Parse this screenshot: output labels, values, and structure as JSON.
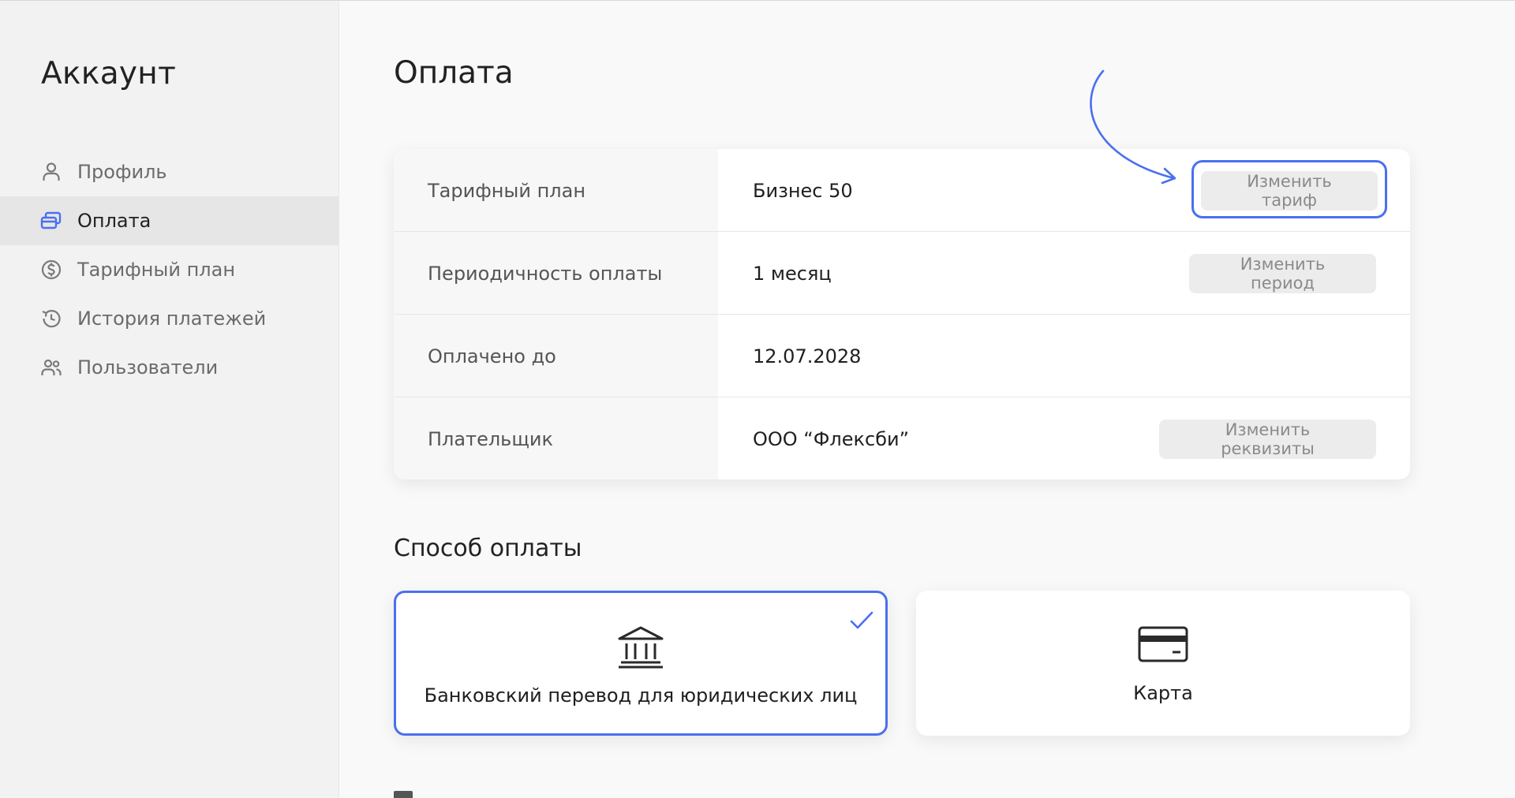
{
  "sidebar": {
    "title": "Аккаунт",
    "items": [
      {
        "label": "Профиль",
        "icon": "user-icon"
      },
      {
        "label": "Оплата",
        "icon": "card-icon",
        "active": true
      },
      {
        "label": "Тарифный план",
        "icon": "dollar-circle-icon"
      },
      {
        "label": "История платежей",
        "icon": "history-icon"
      },
      {
        "label": "Пользователи",
        "icon": "users-icon"
      }
    ]
  },
  "main": {
    "title": "Оплата",
    "info": [
      {
        "label": "Тарифный план",
        "value": "Бизнес 50",
        "button": "Изменить тариф"
      },
      {
        "label": "Периодичность оплаты",
        "value": "1 месяц",
        "button": "Изменить период"
      },
      {
        "label": "Оплачено до",
        "value": "12.07.2028"
      },
      {
        "label": "Плательщик",
        "value": "ООО “Флексби”",
        "button": "Изменить реквизиты"
      }
    ],
    "payment_section_title": "Способ оплаты",
    "payment_methods": [
      {
        "label": "Банковский перевод для юридических лиц",
        "icon": "bank-icon",
        "selected": true
      },
      {
        "label": "Карта",
        "icon": "credit-card-icon",
        "selected": false
      }
    ]
  },
  "colors": {
    "accent": "#4a6ff0",
    "sidebar_bg": "#f2f2f2",
    "active_item_bg": "#e6e6e6",
    "button_bg": "#ececec"
  }
}
